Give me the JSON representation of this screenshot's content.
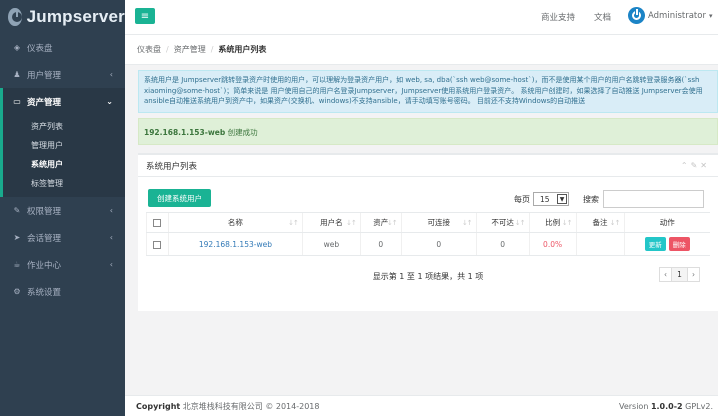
{
  "brand": {
    "name": "Jumpserver"
  },
  "sidebar": {
    "items": [
      {
        "label": "仪表盘",
        "icon": "dashboard-icon",
        "glyph": "◈"
      },
      {
        "label": "用户管理",
        "icon": "users-icon",
        "glyph": "♟"
      },
      {
        "label": "资产管理",
        "icon": "inbox-icon",
        "glyph": "▭"
      },
      {
        "label": "权限管理",
        "icon": "edit-icon",
        "glyph": "✎"
      },
      {
        "label": "会话管理",
        "icon": "rocket-icon",
        "glyph": "➤"
      },
      {
        "label": "作业中心",
        "icon": "coffee-icon",
        "glyph": "☕"
      },
      {
        "label": "系统设置",
        "icon": "gears-icon",
        "glyph": "⚙"
      }
    ],
    "asset_sub": [
      "资产列表",
      "管理用户",
      "系统用户",
      "标签管理"
    ]
  },
  "topbar": {
    "support": "商业支持",
    "docs": "文档",
    "user": "Administrator"
  },
  "breadcrumb": [
    "仪表盘",
    "资产管理",
    "系统用户列表"
  ],
  "alerts": {
    "info": "系统用户是 Jumpserver跳转登录资产时使用的用户，可以理解为登录资产用户，如 web, sa, dba(`ssh web@some-host`)，而不是使用某个用户的用户名跳转登录服务器(`ssh xiaoming@some-host`)；简单来说是 用户使用自己的用户名登录Jumpserver，Jumpserver使用系统用户登录资产。 系统用户创建时，如果选择了自动推送 Jumpserver会使用ansible自动推送系统用户到资产中，如果资产(交换机、windows)不支持ansible，请手动填写账号密码。 目前还不支持Windows的自动推送",
    "success_name": "192.168.1.153-web",
    "success_text": " 创建成功"
  },
  "panel": {
    "title": "系统用户列表",
    "create_button": "创建系统用户",
    "per_page_label": "每页",
    "per_page_value": "15",
    "search_label": "搜索",
    "search_value": ""
  },
  "table": {
    "headers": [
      "名称",
      "用户名",
      "资产",
      "可连接",
      "不可达",
      "比例",
      "备注",
      "动作"
    ],
    "rows": [
      {
        "name": "192.168.1.153-web",
        "username": "web",
        "assets": "0",
        "reachable": "0",
        "unreachable": "0",
        "ratio": "0.0%",
        "comment": "",
        "update": "更新",
        "delete": "删除"
      }
    ]
  },
  "pagination": {
    "info": "显示第 1 至 1 项结果，共 1 项",
    "prev": "‹",
    "page": "1",
    "next": "›"
  },
  "footer": {
    "copyright_label": "Copyright",
    "copyright_text": " 北京堆栈科技有限公司 © 2014-2018",
    "version_label": "Version ",
    "version_value": "1.0.0-2",
    "license": " GPLv2."
  },
  "colors": {
    "sidebar_bg": "#2f4050",
    "accent": "#1ab394",
    "info_bg": "#d9edf7",
    "success_bg": "#dff0d8",
    "danger": "#ed5565",
    "update_btn": "#23c6c8"
  }
}
